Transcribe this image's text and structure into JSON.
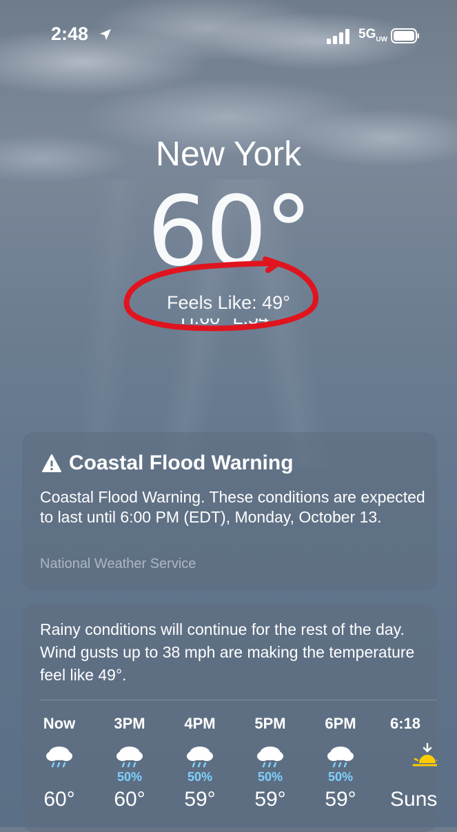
{
  "status_bar": {
    "time": "2:48",
    "network": "5G",
    "network_sub": "UW"
  },
  "location": {
    "city": "New York",
    "temperature": "60°",
    "feels_like": "Feels Like: 49°",
    "hi_lo": "H:60° L:54°"
  },
  "alert": {
    "title": "Coastal Flood Warning",
    "body": "Coastal Flood Warning. These conditions are expected to last until 6:00 PM (EDT), Monday, October 13.",
    "source": "National Weather Service"
  },
  "forecast": {
    "summary": "Rainy conditions will continue for the rest of the day. Wind gusts up to 38 mph are making the temperature feel like 49°.",
    "hours": [
      {
        "label": "Now",
        "icon": "rain-cloud-icon",
        "pop": "",
        "temp": "60°"
      },
      {
        "label": "3PM",
        "icon": "rain-cloud-icon",
        "pop": "50%",
        "temp": "60°"
      },
      {
        "label": "4PM",
        "icon": "rain-cloud-icon",
        "pop": "50%",
        "temp": "59°"
      },
      {
        "label": "5PM",
        "icon": "rain-cloud-icon",
        "pop": "50%",
        "temp": "59°"
      },
      {
        "label": "6PM",
        "icon": "rain-cloud-icon",
        "pop": "50%",
        "temp": "59°"
      },
      {
        "label": "6:18",
        "icon": "sunset-icon",
        "pop": "",
        "temp": "Sunset"
      }
    ]
  },
  "colors": {
    "annotation": "#e0141e",
    "precip": "#7fd1ff",
    "sun": "#ffcc00"
  }
}
